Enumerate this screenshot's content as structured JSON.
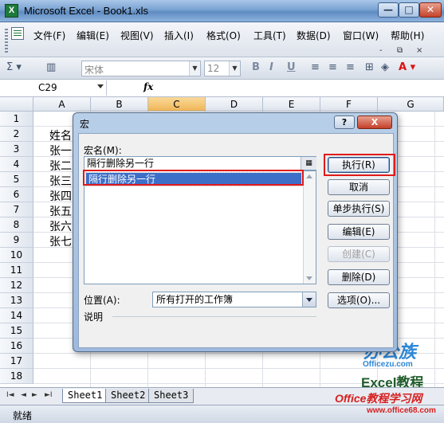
{
  "window": {
    "title": "Microsoft Excel - Book1.xls",
    "min": "—",
    "max": "□",
    "close": "✕"
  },
  "menu": {
    "items": [
      "文件(F)",
      "编辑(E)",
      "视图(V)",
      "插入(I)",
      "格式(O)",
      "工具(T)",
      "数据(D)",
      "窗口(W)",
      "帮助(H)"
    ],
    "controls": [
      "-",
      "⧉",
      "×"
    ]
  },
  "toolbar": {
    "font_name": "宋体",
    "font_size": "12",
    "icons": [
      "sigma-icon",
      "chart-icon",
      "bold-icon",
      "italic-icon",
      "underline-icon",
      "align-left-icon",
      "align-center-icon",
      "align-right-icon",
      "merge-icon",
      "borders-icon",
      "fill-color-icon",
      "font-color-icon"
    ]
  },
  "formula_bar": {
    "name_box": "C29",
    "fx": "fx"
  },
  "grid": {
    "columns": [
      "A",
      "B",
      "C",
      "D",
      "E",
      "F",
      "G"
    ],
    "selected_column": "C",
    "rows": [
      "1",
      "2",
      "3",
      "4",
      "5",
      "6",
      "7",
      "8",
      "9",
      "10",
      "11",
      "12",
      "13",
      "14",
      "15",
      "16",
      "17",
      "18"
    ],
    "column_a_values": [
      "",
      "姓名",
      "张一",
      "张二",
      "张三",
      "张四",
      "张五",
      "张六",
      "张七"
    ]
  },
  "sheets": {
    "nav": [
      "I◄",
      "◄",
      "►",
      "►I"
    ],
    "tabs": [
      "Sheet1",
      "Sheet2",
      "Sheet3"
    ],
    "active": "Sheet1"
  },
  "status": {
    "text": "就绪"
  },
  "dialog": {
    "title": "宏",
    "help": "?",
    "close": "X",
    "macro_name_label": "宏名(M):",
    "macro_name_value": "隔行删除另一行",
    "macro_list": [
      "隔行删除另一行"
    ],
    "buttons": {
      "run": "执行(R)",
      "cancel": "取消",
      "step": "单步执行(S)",
      "edit": "编辑(E)",
      "create": "创建(C)",
      "delete": "删除(D)",
      "options": "选项(O)..."
    },
    "location_label": "位置(A):",
    "location_value": "所有打开的工作簿",
    "description_label": "说明"
  },
  "watermark": {
    "line1": "办公族",
    "line2": "Officezu.com",
    "line3": "Excel教程",
    "line4": "Office教程学习网",
    "line5": "www.office68.com"
  },
  "colors": {
    "highlight_box": "#e01a1a",
    "selection": "#3d6fc8"
  }
}
